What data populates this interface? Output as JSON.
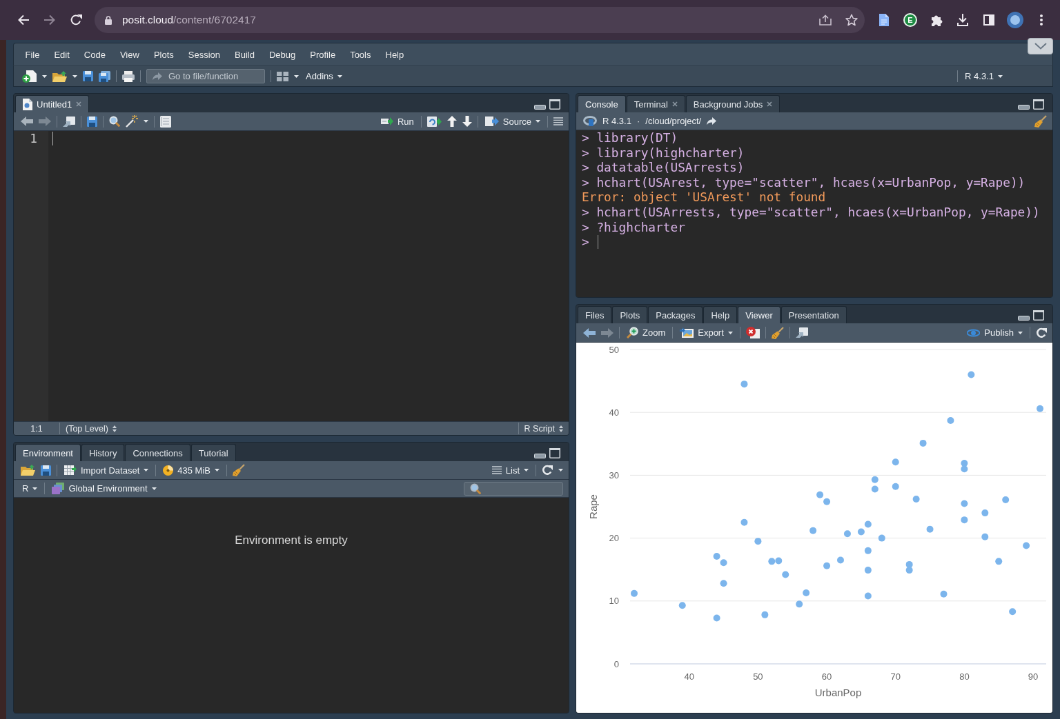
{
  "browser": {
    "url": {
      "host": "posit.cloud",
      "path": "/content/6702417"
    },
    "extension_letter": "E"
  },
  "menubar": {
    "items": [
      "File",
      "Edit",
      "Code",
      "View",
      "Plots",
      "Session",
      "Build",
      "Debug",
      "Profile",
      "Tools",
      "Help"
    ]
  },
  "main_toolbar": {
    "go_to_placeholder": "Go to file/function",
    "addins": "Addins",
    "r_version": "R 4.3.1"
  },
  "source_pane": {
    "tabs": [
      {
        "label": "Untitled1",
        "selected": true,
        "closable": true
      }
    ],
    "toolbar": {
      "run": "Run",
      "source": "Source"
    },
    "line_numbers": [
      "1"
    ],
    "status_bar": {
      "position": "1:1",
      "scope": "(Top Level)",
      "file_type": "R Script"
    }
  },
  "environment_pane": {
    "tabs": [
      {
        "label": "Environment",
        "selected": true
      },
      {
        "label": "History",
        "selected": false
      },
      {
        "label": "Connections",
        "selected": false
      },
      {
        "label": "Tutorial",
        "selected": false
      }
    ],
    "toolbar": {
      "import": "Import Dataset",
      "memory": "435 MiB",
      "view_mode": "List"
    },
    "language": "R",
    "environment": "Global Environment",
    "message": "Environment is empty"
  },
  "console_pane": {
    "tabs": [
      {
        "label": "Console",
        "selected": true,
        "closable": false
      },
      {
        "label": "Terminal",
        "selected": false,
        "closable": true
      },
      {
        "label": "Background Jobs",
        "selected": false,
        "closable": true
      }
    ],
    "r_version": "R 4.3.1",
    "separator": "·",
    "working_dir": "/cloud/project/",
    "lines": [
      {
        "kind": "input",
        "text": "> library(DT)"
      },
      {
        "kind": "input",
        "text": "> library(highcharter)"
      },
      {
        "kind": "input",
        "text": "> datatable(USArrests)"
      },
      {
        "kind": "input",
        "text": "> hchart(USArest, type=\"scatter\", hcaes(x=UrbanPop, y=Rape))"
      },
      {
        "kind": "error",
        "text": "Error: object 'USArest' not found"
      },
      {
        "kind": "input",
        "text": "> hchart(USArrests, type=\"scatter\", hcaes(x=UrbanPop, y=Rape))"
      },
      {
        "kind": "input",
        "text": "> ?highcharter"
      },
      {
        "kind": "prompt",
        "text": ">"
      }
    ]
  },
  "viewer_pane": {
    "tabs": [
      {
        "label": "Files",
        "selected": false
      },
      {
        "label": "Plots",
        "selected": false
      },
      {
        "label": "Packages",
        "selected": false
      },
      {
        "label": "Help",
        "selected": false
      },
      {
        "label": "Viewer",
        "selected": true
      },
      {
        "label": "Presentation",
        "selected": false
      }
    ],
    "toolbar": {
      "zoom": "Zoom",
      "export": "Export",
      "publish": "Publish"
    },
    "chart_data": {
      "type": "scatter",
      "xlabel": "UrbanPop",
      "ylabel": "Rape",
      "xlim": [
        31.4,
        91.9
      ],
      "ylim": [
        0,
        50
      ],
      "xticks": [
        40,
        50,
        60,
        70,
        80,
        90
      ],
      "yticks": [
        0,
        10,
        20,
        30,
        40,
        50
      ],
      "grid": true,
      "x": [
        58,
        48,
        80,
        50,
        91,
        78,
        77,
        72,
        80,
        60,
        83,
        54,
        83,
        65,
        57,
        66,
        52,
        66,
        51,
        67,
        85,
        74,
        66,
        44,
        70,
        53,
        62,
        81,
        56,
        89,
        70,
        86,
        45,
        44,
        75,
        68,
        67,
        72,
        87,
        48,
        45,
        59,
        80,
        80,
        32,
        63,
        73,
        39,
        66,
        60
      ],
      "series": [
        {
          "color": "#7cb5ec",
          "values": [
            21.2,
            44.5,
            31.0,
            19.5,
            40.6,
            38.7,
            11.1,
            15.8,
            31.9,
            25.8,
            20.2,
            14.2,
            24.0,
            21.0,
            11.3,
            18.0,
            16.3,
            22.2,
            7.8,
            27.8,
            16.3,
            35.1,
            14.9,
            17.1,
            28.2,
            16.4,
            16.5,
            46.0,
            9.5,
            18.8,
            32.1,
            26.1,
            16.1,
            7.3,
            21.4,
            20.0,
            29.3,
            14.9,
            8.3,
            22.5,
            12.8,
            26.9,
            25.5,
            22.9,
            11.2,
            20.7,
            26.2,
            9.3,
            10.8,
            15.6
          ]
        }
      ]
    }
  }
}
